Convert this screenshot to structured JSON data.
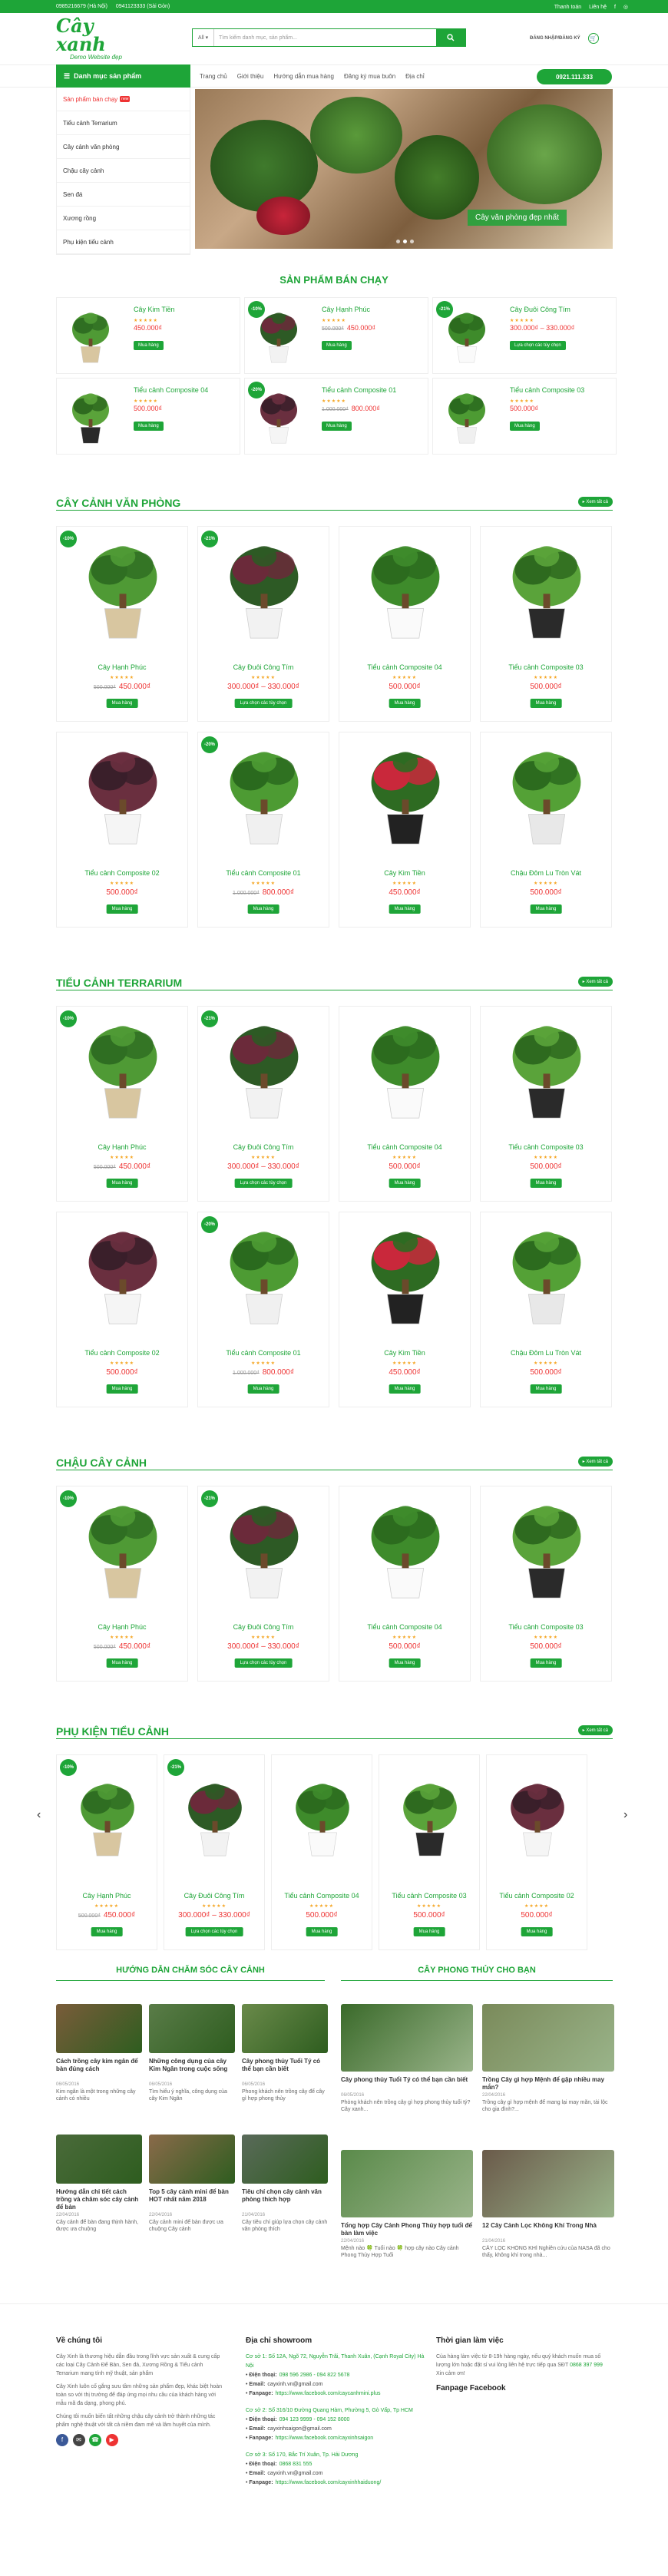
{
  "topbar": {
    "phone_hn": "0985216679 (Hà Nội)",
    "phone_sg": "0941123333 (Sài Gòn)",
    "links": [
      "Thanh toán",
      "Liên hệ"
    ]
  },
  "header": {
    "logo_text": "Cây xanh",
    "logo_sub": "Demo Website đẹp",
    "search_select": "All",
    "search_placeholder": "Tìm kiếm danh mục, sản phẩm...",
    "account": "ĐĂNG NHẬP/ĐĂNG KÝ"
  },
  "nav": {
    "categories_label": "Danh mục sản phẩm",
    "menu": [
      "Trang chủ",
      "Giới thiệu",
      "Hướng dẫn mua hàng",
      "Đăng ký mua buôn",
      "Địa chỉ"
    ],
    "hotline": "0921.111.333"
  },
  "sidebar": {
    "hot_item": "Sản phẩm bán chạy",
    "hot_badge": "new",
    "items": [
      "Tiểu cảnh Terrarium",
      "Cây cảnh văn phòng",
      "Chậu cây cảnh",
      "Sen đá",
      "Xương rồng",
      "Phụ kiện tiểu cảnh"
    ]
  },
  "hero": {
    "caption": "Cây văn phòng đẹp nhất"
  },
  "bestseller": {
    "title": "SẢN PHẨM BÁN CHẠY",
    "items": [
      {
        "name": "Cây Kim Tiền",
        "price": "450.000₫",
        "old": "",
        "disc": "",
        "action": "Mua hàng"
      },
      {
        "name": "Cây Hạnh Phúc",
        "price": "450.000₫",
        "old": "500.000₫",
        "disc": "-10%",
        "action": "Mua hàng"
      },
      {
        "name": "Cây Đuôi Công Tím",
        "price": "300.000₫ – 330.000₫",
        "old": "",
        "disc": "-21%",
        "action": "Lựa chọn các tùy chọn"
      },
      {
        "name": "Tiểu cảnh Composite 04",
        "price": "500.000₫",
        "old": "",
        "disc": "",
        "action": "Mua hàng"
      },
      {
        "name": "Tiểu cảnh Composite 01",
        "price": "800.000₫",
        "old": "1.000.000₫",
        "disc": "-20%",
        "action": "Mua hàng"
      },
      {
        "name": "Tiểu cảnh Composite 03",
        "price": "500.000₫",
        "old": "",
        "disc": "",
        "action": "Mua hàng"
      }
    ]
  },
  "office": {
    "title": "CÂY CẢNH VĂN PHÒNG",
    "more": "Xem tất cả",
    "items": [
      {
        "name": "Cây Hạnh Phúc",
        "price": "450.000₫",
        "old": "500.000₫",
        "disc": "-10%",
        "action": "Mua hàng"
      },
      {
        "name": "Cây Đuôi Công Tím",
        "price": "300.000₫ – 330.000₫",
        "old": "",
        "disc": "-21%",
        "action": "Lựa chọn các tùy chọn"
      },
      {
        "name": "Tiểu cảnh Composite 04",
        "price": "500.000₫",
        "old": "",
        "disc": "",
        "action": "Mua hàng"
      },
      {
        "name": "Tiểu cảnh Composite 03",
        "price": "500.000₫",
        "old": "",
        "disc": "",
        "action": "Mua hàng"
      },
      {
        "name": "Tiểu cảnh Composite 02",
        "price": "500.000₫",
        "old": "",
        "disc": "",
        "action": "Mua hàng"
      },
      {
        "name": "Tiểu cảnh Composite 01",
        "price": "800.000₫",
        "old": "1.000.000₫",
        "disc": "-20%",
        "action": "Mua hàng"
      },
      {
        "name": "Cây Kim Tiền",
        "price": "450.000₫",
        "old": "",
        "disc": "",
        "action": "Mua hàng"
      },
      {
        "name": "Chậu Đôm Lu Tròn Vát",
        "price": "500.000₫",
        "old": "",
        "disc": "",
        "action": "Mua hàng"
      }
    ]
  },
  "terrarium": {
    "title": "TIỂU CẢNH TERRARIUM",
    "more": "Xem tất cả",
    "items": [
      {
        "name": "Cây Hạnh Phúc",
        "price": "450.000₫",
        "old": "500.000₫",
        "disc": "-10%",
        "action": "Mua hàng"
      },
      {
        "name": "Cây Đuôi Công Tím",
        "price": "300.000₫ – 330.000₫",
        "old": "",
        "disc": "-21%",
        "action": "Lựa chọn các tùy chọn"
      },
      {
        "name": "Tiểu cảnh Composite 04",
        "price": "500.000₫",
        "old": "",
        "disc": "",
        "action": "Mua hàng"
      },
      {
        "name": "Tiểu cảnh Composite 03",
        "price": "500.000₫",
        "old": "",
        "disc": "",
        "action": "Mua hàng"
      },
      {
        "name": "Tiểu cảnh Composite 02",
        "price": "500.000₫",
        "old": "",
        "disc": "",
        "action": "Mua hàng"
      },
      {
        "name": "Tiểu cảnh Composite 01",
        "price": "800.000₫",
        "old": "1.000.000₫",
        "disc": "-20%",
        "action": "Mua hàng"
      },
      {
        "name": "Cây Kim Tiền",
        "price": "450.000₫",
        "old": "",
        "disc": "",
        "action": "Mua hàng"
      },
      {
        "name": "Chậu Đôm Lu Tròn Vát",
        "price": "500.000₫",
        "old": "",
        "disc": "",
        "action": "Mua hàng"
      }
    ]
  },
  "pots": {
    "title": "CHẬU CÂY CẢNH",
    "more": "Xem tất cả",
    "items": [
      {
        "name": "Cây Hạnh Phúc",
        "price": "450.000₫",
        "old": "500.000₫",
        "disc": "-10%",
        "action": "Mua hàng"
      },
      {
        "name": "Cây Đuôi Công Tím",
        "price": "300.000₫ – 330.000₫",
        "old": "",
        "disc": "-21%",
        "action": "Lựa chọn các tùy chọn"
      },
      {
        "name": "Tiểu cảnh Composite 04",
        "price": "500.000₫",
        "old": "",
        "disc": "",
        "action": "Mua hàng"
      },
      {
        "name": "Tiểu cảnh Composite 03",
        "price": "500.000₫",
        "old": "",
        "disc": "",
        "action": "Mua hàng"
      }
    ]
  },
  "accessories": {
    "title": "PHỤ KIỆN TIỂU CẢNH",
    "more": "Xem tất cả",
    "items": [
      {
        "name": "Cây Hạnh Phúc",
        "price": "450.000₫",
        "old": "500.000₫",
        "disc": "-10%",
        "action": "Mua hàng"
      },
      {
        "name": "Cây Đuôi Công Tím",
        "price": "300.000₫ – 330.000₫",
        "old": "",
        "disc": "-21%",
        "action": "Lựa chọn các tùy chọn"
      },
      {
        "name": "Tiểu cảnh Composite 04",
        "price": "500.000₫",
        "old": "",
        "disc": "",
        "action": "Mua hàng"
      },
      {
        "name": "Tiểu cảnh Composite 03",
        "price": "500.000₫",
        "old": "",
        "disc": "",
        "action": "Mua hàng"
      },
      {
        "name": "Tiểu cảnh Composite 02",
        "price": "500.000₫",
        "old": "",
        "disc": "",
        "action": "Mua hàng"
      }
    ]
  },
  "guide": {
    "title": "HƯỚNG DẪN CHĂM SÓC CÂY CẢNH",
    "items": [
      {
        "title": "Cách trồng cây kim ngân để bàn đúng cách",
        "date": "06/05/2016",
        "excerpt": "Kim ngân là một trong những cây cảnh có nhiều"
      },
      {
        "title": "Những công dụng của cây Kim Ngân trong cuộc sống",
        "date": "06/05/2016",
        "excerpt": "Tìm hiểu ý nghĩa, công dụng của cây Kim Ngân"
      },
      {
        "title": "Cây phong thủy Tuổi Tý có thể bạn cần biết",
        "date": "06/05/2016",
        "excerpt": "Phong khách nên trồng cây để cây gì hợp phong thủy"
      },
      {
        "title": "Hướng dẫn chi tiết cách trồng và chăm sóc cây cảnh để bàn",
        "date": "22/04/2016",
        "excerpt": "Cây cảnh để bàn đang thịnh hành, được ưa chuộng"
      },
      {
        "title": "Top 5 cây cảnh mini để bàn HOT nhất năm 2018",
        "date": "22/04/2016",
        "excerpt": "Cây cảnh mini để bàn được ưa chuộng Cây cảnh"
      },
      {
        "title": "Tiêu chí chọn cây cảnh văn phòng thích hợp",
        "date": "21/04/2016",
        "excerpt": "Cây tiêu chí giúp lựa chọn cây cảnh văn phòng thích"
      }
    ]
  },
  "fengshui": {
    "title": "CÂY PHONG THỦY CHO BẠN",
    "items": [
      {
        "title": "Cây phong thủy Tuổi Tý có thể bạn cần biết",
        "date": "06/05/2016",
        "excerpt": "Phòng khách nên trồng cây gì hợp phong thủy tuổi tý? Cây xanh..."
      },
      {
        "title": "Trồng Cây gì hợp Mệnh để gặp nhiều may mắn?",
        "date": "22/04/2016",
        "excerpt": "Trồng cây gì hợp mệnh để mang lại may mắn, tài lộc cho gia đình?..."
      },
      {
        "title": "Tổng hợp Cây Cảnh Phong Thủy hợp tuổi để bàn làm việc",
        "date": "22/04/2016",
        "excerpt": "Mệnh nào 🍀 Tuổi nào 🍀 hợp cây nào Cây cảnh Phong Thủy Hợp Tuổi"
      },
      {
        "title": "12 Cây Cảnh Lọc Không Khí Trong Nhà",
        "date": "21/04/2016",
        "excerpt": "CÂY LỌC KHÔNG KHÍ Nghiên cứu của NASA đã cho thấy, không khí trong nhà..."
      }
    ]
  },
  "footer": {
    "about_title": "Về chúng tôi",
    "about_text1": "Cây Xinh là thương hiệu dẫn đầu trong lĩnh vực sản xuất & cung cấp các loại Cây Cảnh Để Bàn, Sen đá, Xương Rồng & Tiểu cảnh Terrarium mang tính mỹ thuật, sản phẩm",
    "about_text2": "Cây Xinh luôn cố gắng sưu tầm những sản phẩm đẹp, khác biệt hoàn toàn so với thị trường để đáp ứng mọi nhu cầu của khách hàng với mẫu mã đa dạng, phong phú.",
    "about_text3": "Chúng tôi muốn biến tất những chậu cây cảnh trở thành những tác phẩm nghệ thuật với tất cả niềm đam mê và lâm huyết của mình.",
    "showroom_title": "Địa chỉ showroom",
    "showrooms": [
      {
        "address": "Cơ sở 1: Số 12A, Ngõ 72, Nguyễn Trãi, Thanh Xuân, (Cạnh Royal City) Hà Nội",
        "phone": "098 596 2986 - 094 822 5678",
        "email": "cayxinh.vn@gmail.com",
        "fanpage": "https://www.facebook.com/caycanhmini.plus"
      },
      {
        "address": "Cơ sở 2: Số 316/10 Đường Quang Hàm, Phường 5, Gò Vấp, Tp HCM",
        "phone": "094 123 9999 - 094 152 8000",
        "email": "cayxinhsaigon@gmail.com",
        "fanpage": "https://www.facebook.com/cayxinhsaigon"
      },
      {
        "address": "Cơ sở 3: Số 170, Bắc Trí Xuân, Tp. Hải Dương",
        "phone": "0868 831 555",
        "email": "cayxinh.vn@gmail.com",
        "fanpage": "https://www.facebook.com/cayxinhhaiduong/"
      }
    ],
    "labels": {
      "phone": "Điện thoại:",
      "email": "Email:",
      "fanpage": "Fanpage:"
    },
    "hours_title": "Thời gian làm việc",
    "hours_text": "Của hàng làm việc từ 8-19h hàng ngày, nếu quý khách muốn mua số lượng lớn hoặc đặt sỉ vui lòng liên hệ trực tiếp qua SĐT",
    "hours_phone": "0868 397 999",
    "hours_thanks": "Xin cảm ơn!",
    "fanpage_title": "Fanpage Facebook"
  },
  "colors": {
    "brand": "#1ea538",
    "price": "#e33333",
    "star": "#f5a623"
  }
}
